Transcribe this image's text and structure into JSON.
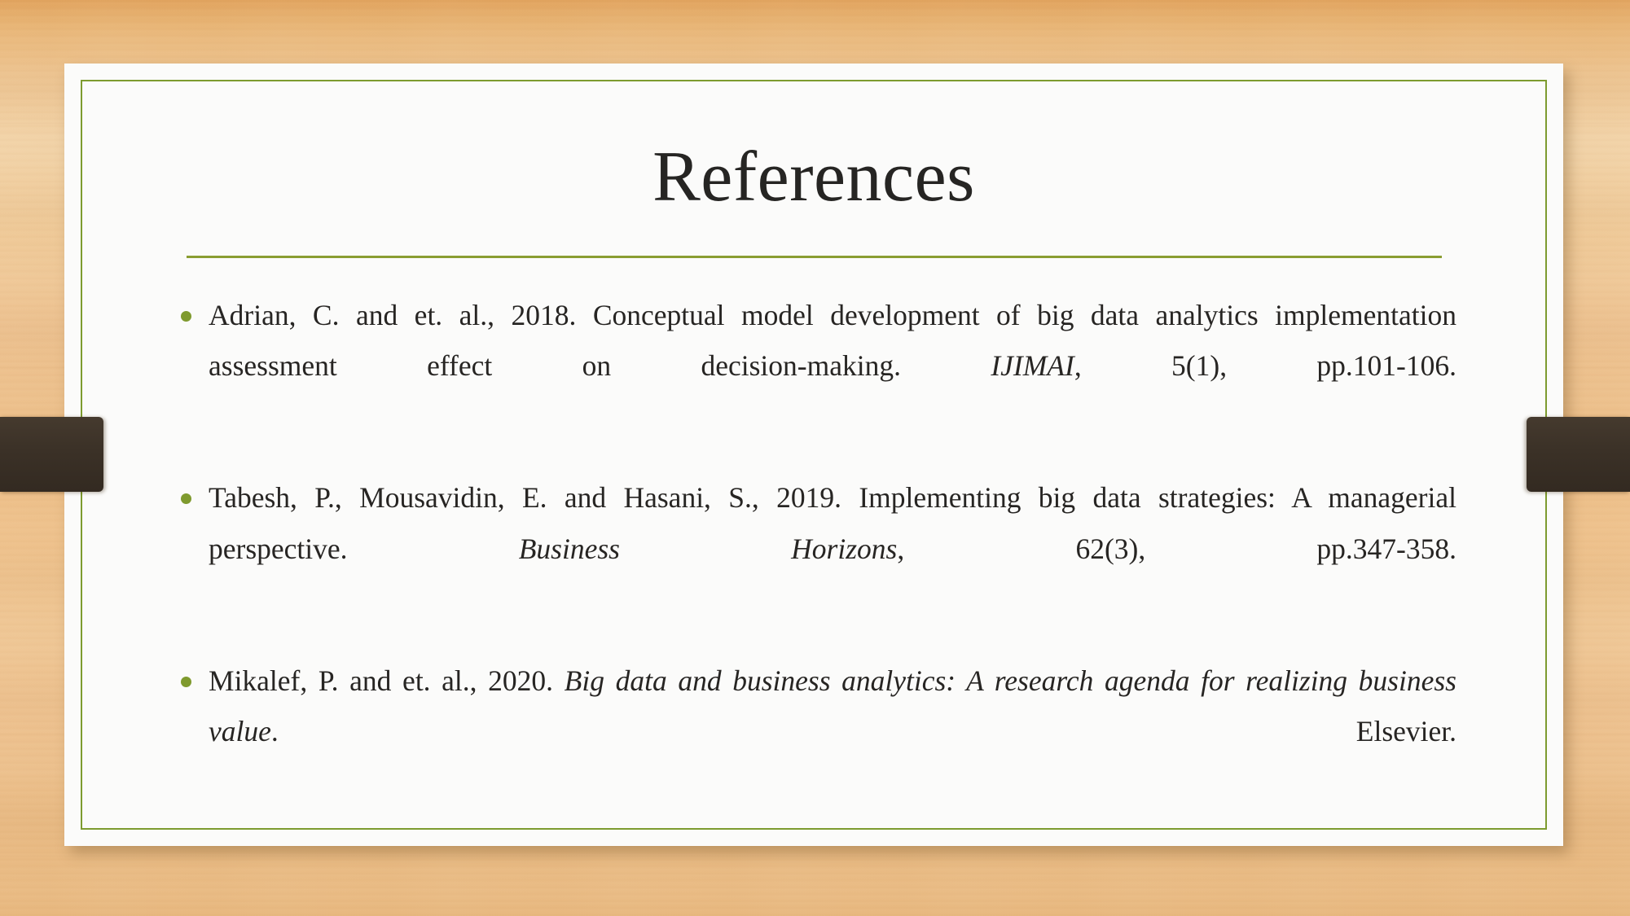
{
  "slide": {
    "title": "References",
    "background": {
      "style": "wood-texture",
      "base_color": "#eec392",
      "ribbon_color": "#3b3127"
    },
    "card": {
      "background_color": "#fbfbfa",
      "border_color": "#7d9b2f"
    },
    "divider_color": "#8a9d31",
    "bullet_color": "#7f9a2e",
    "text_color": "#272523"
  },
  "references": [
    {
      "id": "ref-adrian-2018",
      "bullet": "bullet-dot",
      "parts": [
        {
          "text": "Adrian, C. and et. al., 2018. Conceptual model development of big data analytics implementation assessment effect on decision-making. ",
          "italic": false
        },
        {
          "text": "IJIMAI",
          "italic": true
        },
        {
          "text": ", 5(1), pp.101-106.",
          "italic": false
        }
      ]
    },
    {
      "id": "ref-tabesh-2019",
      "bullet": "bullet-dot",
      "parts": [
        {
          "text": "Tabesh, P., Mousavidin, E. and Hasani, S., 2019. Implementing big data strategies: A managerial perspective. ",
          "italic": false
        },
        {
          "text": "Business Horizons",
          "italic": true
        },
        {
          "text": ", 62(3), pp.347-358.",
          "italic": false
        }
      ]
    },
    {
      "id": "ref-mikalef-2020",
      "bullet": "bullet-dot",
      "parts": [
        {
          "text": "Mikalef, P. and et. al., 2020. ",
          "italic": false
        },
        {
          "text": "Big data and business analytics: A research agenda for realizing business value",
          "italic": true
        },
        {
          "text": ". Elsevier.",
          "italic": false
        }
      ]
    }
  ]
}
